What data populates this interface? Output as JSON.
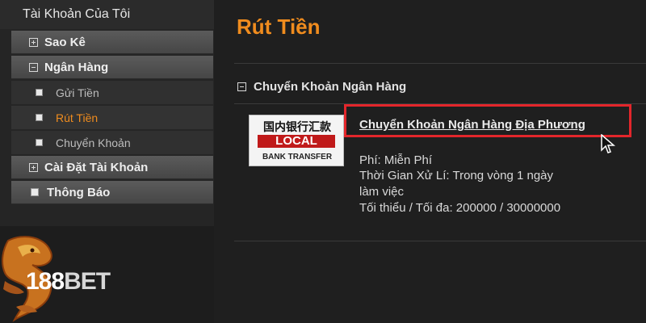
{
  "sidebar": {
    "title": "Tài Khoản Của Tôi",
    "items": [
      {
        "label": "Sao Kê"
      },
      {
        "label": "Ngân Hàng"
      },
      {
        "label": "Gửi Tiền"
      },
      {
        "label": "Rút Tiền"
      },
      {
        "label": "Chuyển Khoản"
      },
      {
        "label": "Cài Đặt Tài Khoản"
      },
      {
        "label": "Thông Báo"
      }
    ]
  },
  "logo": {
    "prefix": "188",
    "suffix": "BET"
  },
  "main": {
    "title": "Rút Tiền",
    "section": "Chuyển Khoản Ngân Hàng",
    "bank": {
      "logo_cn": "国内银行汇款",
      "logo_local": "LOCAL",
      "logo_sub": "BANK TRANSFER",
      "link": "Chuyển Khoản Ngân Hàng Địa Phương",
      "fee": "Phí: Miễn Phí",
      "time_line1": "Thời Gian Xử Lí: Trong vòng 1 ngày",
      "time_line2": "làm việc",
      "limits": "Tối thiểu / Tối đa: 200000 / 30000000"
    }
  },
  "colors": {
    "accent": "#f08c1e",
    "highlight": "#e3262b",
    "local_red": "#c01a1a"
  },
  "icons": [
    "plus-box-icon",
    "minus-box-icon",
    "bullet-icon",
    "dragon-logo-icon",
    "mouse-cursor-icon"
  ]
}
